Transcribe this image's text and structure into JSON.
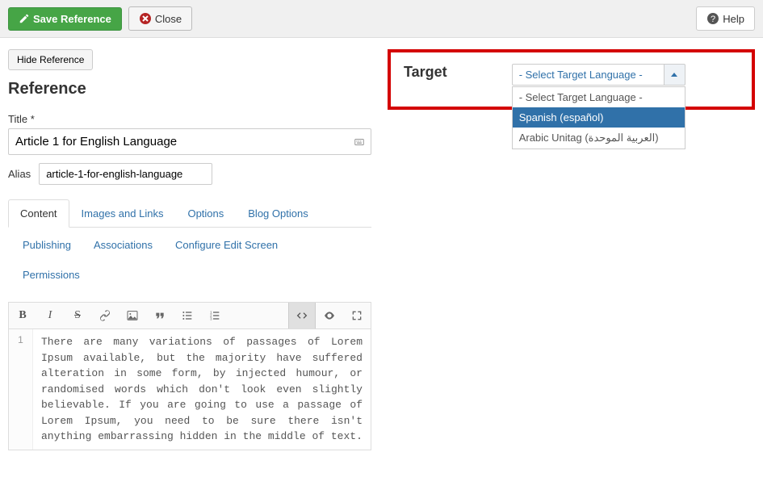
{
  "toolbar": {
    "save_label": "Save Reference",
    "close_label": "Close",
    "help_label": "Help"
  },
  "reference": {
    "hide_button": "Hide Reference",
    "heading": "Reference",
    "title_label": "Title *",
    "title_value": "Article 1 for English Language",
    "alias_label": "Alias",
    "alias_value": "article-1-for-english-language"
  },
  "tabs": {
    "content": "Content",
    "images": "Images and Links",
    "options": "Options",
    "blog": "Blog Options",
    "publishing": "Publishing",
    "associations": "Associations",
    "configure": "Configure Edit Screen",
    "permissions": "Permissions"
  },
  "editor": {
    "line_no": "1",
    "body": "There are many variations of passages of Lorem Ipsum available, but the majority have suffered alteration in some form, by injected humour, or randomised words which don't look even slightly believable. If you are going to use a passage of Lorem Ipsum, you need to be sure there isn't anything embarrassing hidden in the middle of text."
  },
  "target": {
    "heading": "Target",
    "selected": "- Select Target Language -",
    "options": {
      "placeholder": "- Select Target Language -",
      "spanish": "Spanish (español)",
      "arabic": "Arabic Unitag (العربية الموحدة)"
    }
  }
}
